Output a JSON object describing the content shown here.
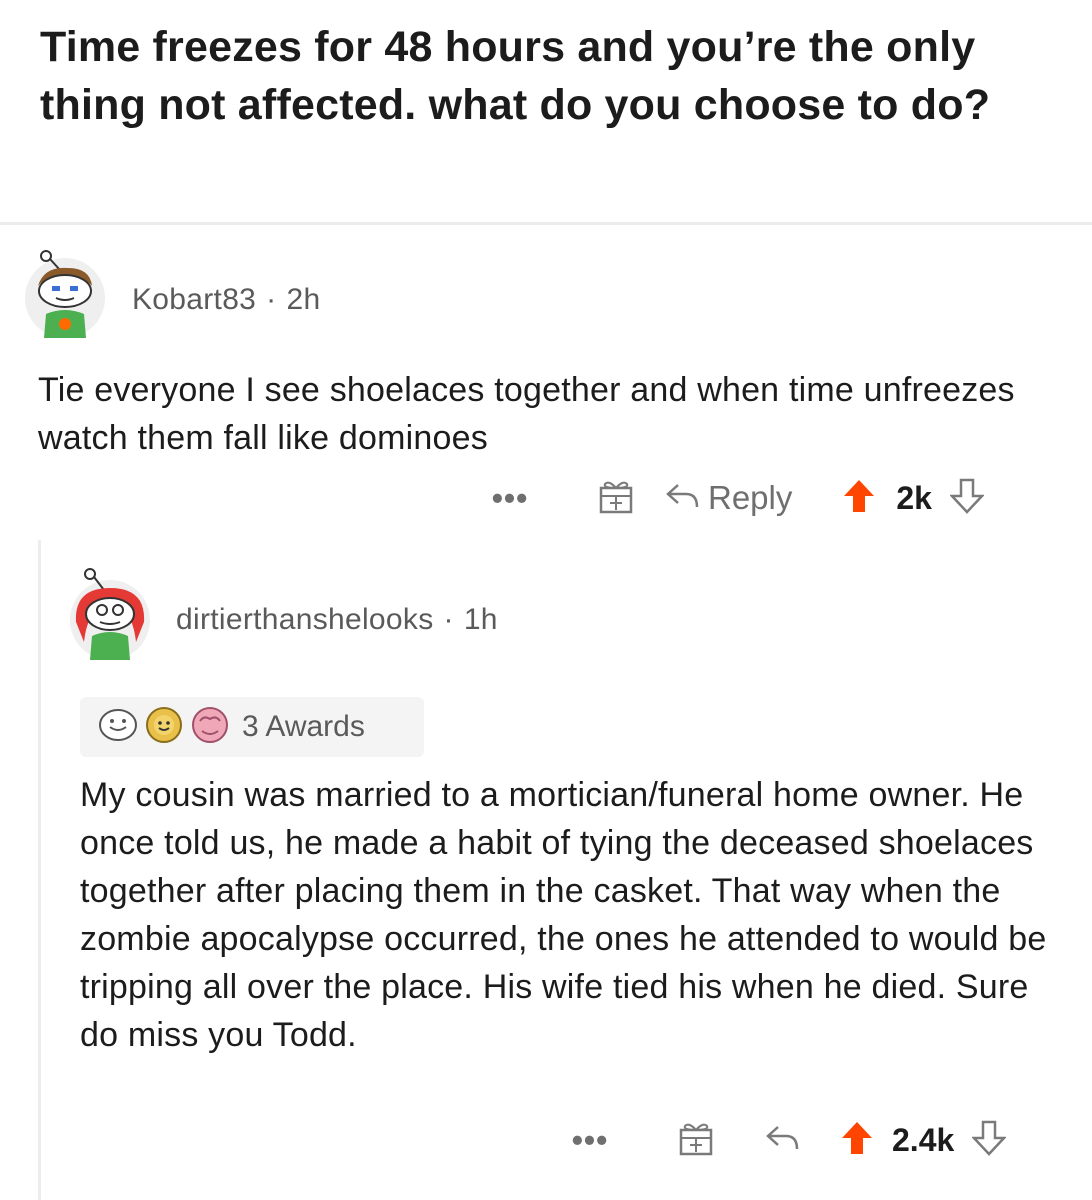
{
  "post": {
    "title": "Time freezes for 48 hours and you’re the only thing not affected. what do you choose to do?"
  },
  "comments": [
    {
      "username": "Kobart83",
      "age": "2h",
      "text": "Tie everyone I see shoelaces together and when time unfreezes watch them fall like dominoes",
      "actions": {
        "more": "•••",
        "reply": "Reply",
        "score": "2k"
      }
    },
    {
      "username": "dirtierthanshelooks",
      "age": "1h",
      "awards_label": "3 Awards",
      "text": "My cousin was married to a mortician/funeral home owner. He once told us, he made a habit of tying the deceased shoelaces together after placing them in the casket. That way when the zombie apocalypse occurred, the ones he attended to would be tripping all over the place. His wife tied his when he died. Sure do miss you Todd.",
      "actions": {
        "more": "•••",
        "score": "2.4k"
      }
    }
  ],
  "colors": {
    "upvote": "#ff4500",
    "meta": "#5a5a5a",
    "text": "#1c1c1c"
  },
  "icons": [
    "avatar",
    "more-icon",
    "gift-icon",
    "reply-icon",
    "upvote-icon",
    "downvote-icon",
    "award-icon"
  ]
}
